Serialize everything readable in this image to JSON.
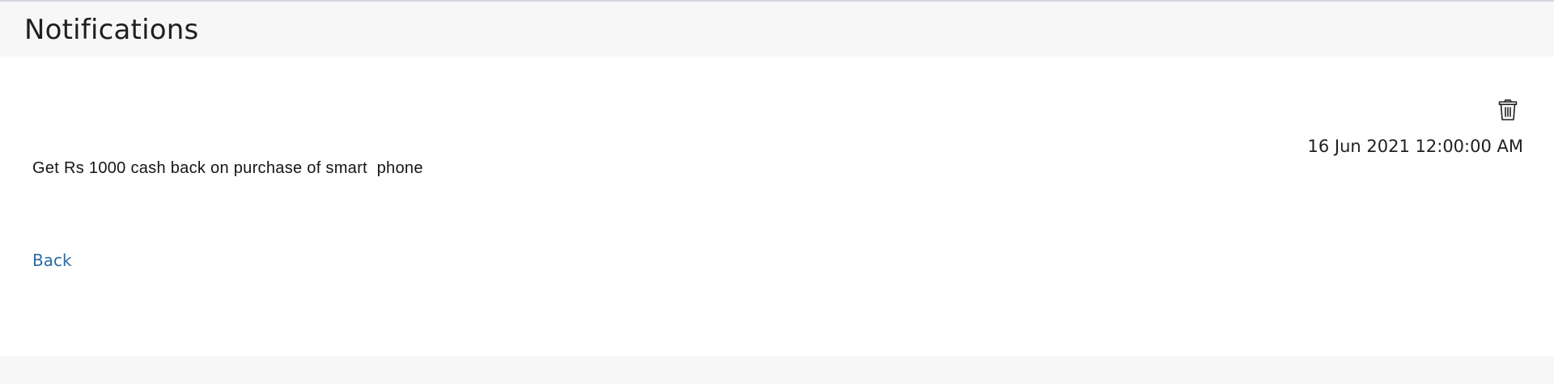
{
  "header": {
    "title": "Notifications"
  },
  "notification": {
    "message": "Get Rs 1000 cash back on purchase of smart  phone",
    "timestamp": "16 Jun 2021 12:00:00 AM",
    "delete_icon": "trash-icon"
  },
  "actions": {
    "back_label": "Back"
  },
  "colors": {
    "link": "#2a6ba6",
    "header_bg": "#f7f7f7",
    "content_bg": "#ffffff",
    "text": "#161513"
  }
}
